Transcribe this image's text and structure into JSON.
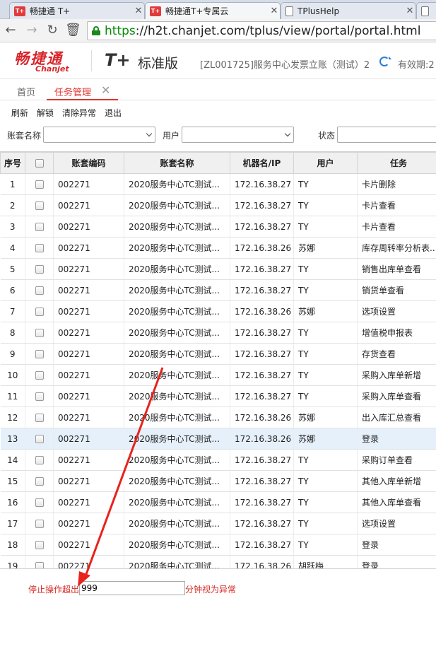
{
  "browser": {
    "tabs": [
      {
        "label": "畅捷通 T+",
        "icon": "tplus-favicon",
        "favicon_text": "T+"
      },
      {
        "label": "畅捷通T+专属云",
        "icon": "tplus-favicon",
        "favicon_text": "T+"
      },
      {
        "label": "TPlusHelp",
        "icon": "document-icon"
      },
      {
        "label": "",
        "icon": "document-icon"
      }
    ],
    "url_scheme": "https",
    "url_rest": "://h2t.chanjet.com/tplus/view/portal/portal.html"
  },
  "header": {
    "logo_cn": "畅捷通",
    "logo_en": "Chanjet",
    "product": "T+",
    "edition": "标准版",
    "account": "[ZL001725]服务中心发票立账（测试）2",
    "validity": "有效期:2"
  },
  "page_tabs": [
    {
      "label": "首页"
    },
    {
      "label": "任务管理"
    }
  ],
  "actions": [
    "刷新",
    "解锁",
    "清除异常",
    "退出"
  ],
  "filters": {
    "account_name_label": "账套名称",
    "user_label": "用户",
    "status_label": "状态"
  },
  "grid": {
    "columns": [
      "序号",
      "",
      "账套编码",
      "账套名称",
      "机器名/IP",
      "用户",
      "任务"
    ],
    "selected_row": 13,
    "rows": [
      {
        "idx": "1",
        "code": "002271",
        "name": "2020服务中心TC测试...",
        "ip": "172.16.38.27",
        "user": "TY",
        "task": "卡片删除"
      },
      {
        "idx": "2",
        "code": "002271",
        "name": "2020服务中心TC测试...",
        "ip": "172.16.38.27",
        "user": "TY",
        "task": "卡片查看"
      },
      {
        "idx": "3",
        "code": "002271",
        "name": "2020服务中心TC测试...",
        "ip": "172.16.38.27",
        "user": "TY",
        "task": "卡片查看"
      },
      {
        "idx": "4",
        "code": "002271",
        "name": "2020服务中心TC测试...",
        "ip": "172.16.38.26",
        "user": "苏娜",
        "task": "库存周转率分析表..."
      },
      {
        "idx": "5",
        "code": "002271",
        "name": "2020服务中心TC测试...",
        "ip": "172.16.38.27",
        "user": "TY",
        "task": "销售出库单查看"
      },
      {
        "idx": "6",
        "code": "002271",
        "name": "2020服务中心TC测试...",
        "ip": "172.16.38.27",
        "user": "TY",
        "task": "销货单查看"
      },
      {
        "idx": "7",
        "code": "002271",
        "name": "2020服务中心TC测试...",
        "ip": "172.16.38.26",
        "user": "苏娜",
        "task": "选项设置"
      },
      {
        "idx": "8",
        "code": "002271",
        "name": "2020服务中心TC测试...",
        "ip": "172.16.38.27",
        "user": "TY",
        "task": "增值税申报表"
      },
      {
        "idx": "9",
        "code": "002271",
        "name": "2020服务中心TC测试...",
        "ip": "172.16.38.27",
        "user": "TY",
        "task": "存货查看"
      },
      {
        "idx": "10",
        "code": "002271",
        "name": "2020服务中心TC测试...",
        "ip": "172.16.38.27",
        "user": "TY",
        "task": "采购入库单新增"
      },
      {
        "idx": "11",
        "code": "002271",
        "name": "2020服务中心TC测试...",
        "ip": "172.16.38.27",
        "user": "TY",
        "task": "采购入库单查看"
      },
      {
        "idx": "12",
        "code": "002271",
        "name": "2020服务中心TC测试...",
        "ip": "172.16.38.26",
        "user": "苏娜",
        "task": "出入库汇总查看"
      },
      {
        "idx": "13",
        "code": "002271",
        "name": "2020服务中心TC测试...",
        "ip": "172.16.38.26",
        "user": "苏娜",
        "task": "登录"
      },
      {
        "idx": "14",
        "code": "002271",
        "name": "2020服务中心TC测试...",
        "ip": "172.16.38.27",
        "user": "TY",
        "task": "采购订单查看"
      },
      {
        "idx": "15",
        "code": "002271",
        "name": "2020服务中心TC测试...",
        "ip": "172.16.38.27",
        "user": "TY",
        "task": "其他入库单新增"
      },
      {
        "idx": "16",
        "code": "002271",
        "name": "2020服务中心TC测试...",
        "ip": "172.16.38.27",
        "user": "TY",
        "task": "其他入库单查看"
      },
      {
        "idx": "17",
        "code": "002271",
        "name": "2020服务中心TC测试...",
        "ip": "172.16.38.27",
        "user": "TY",
        "task": "选项设置"
      },
      {
        "idx": "18",
        "code": "002271",
        "name": "2020服务中心TC测试...",
        "ip": "172.16.38.27",
        "user": "TY",
        "task": "登录"
      },
      {
        "idx": "19",
        "code": "002271",
        "name": "2020服务中心TC测试...",
        "ip": "172.16.38.26",
        "user": "胡跃梅",
        "task": "登录"
      }
    ]
  },
  "footer": {
    "prefix": "停止操作超出",
    "timeout_value": "999",
    "suffix": "分钟视为异常"
  },
  "colors": {
    "brand_red": "#d8262b",
    "tab_active": "#e0342f",
    "annotation_arrow": "#e8231c",
    "selected_row": "#e6f0fb"
  }
}
